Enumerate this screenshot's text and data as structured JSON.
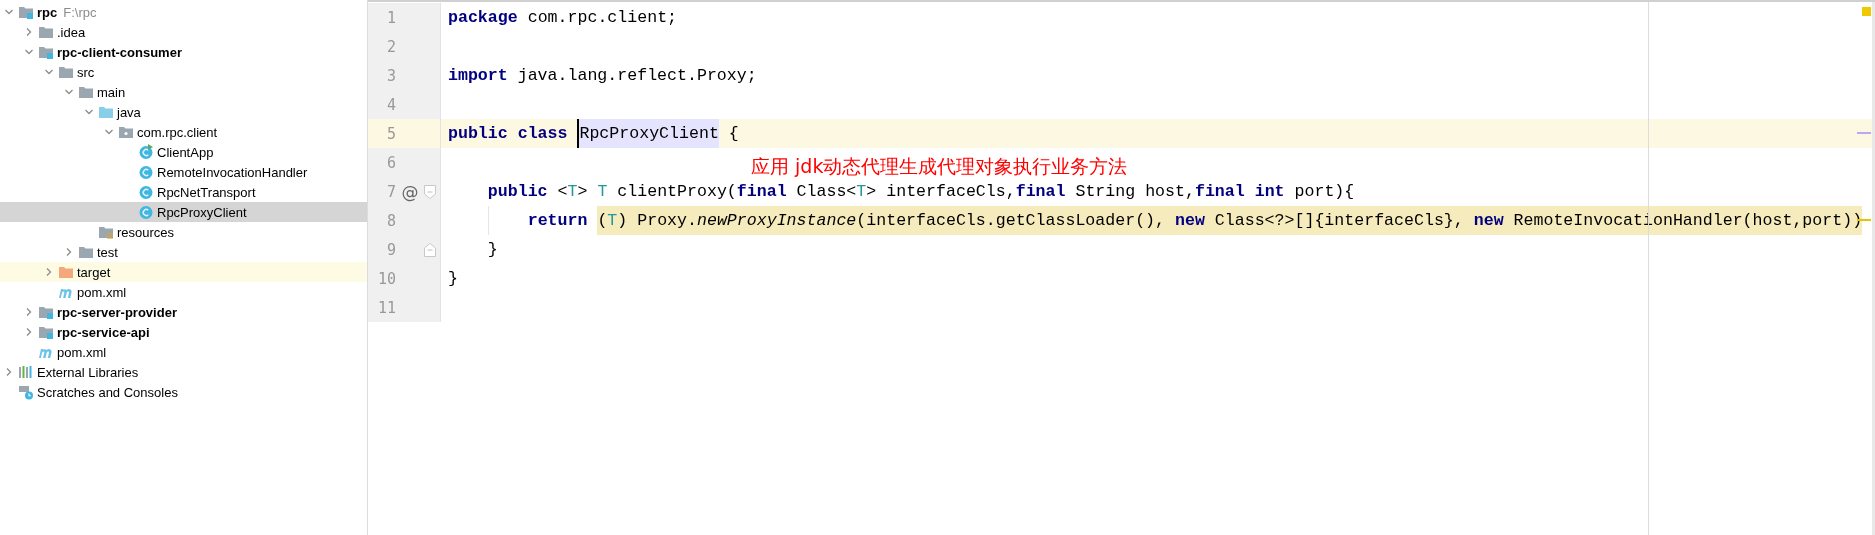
{
  "project_tree": [
    {
      "label": "rpc",
      "path": "F:\\rpc",
      "kind": "module",
      "bold": true,
      "expanded": true,
      "selected": false,
      "children": [
        {
          "label": ".idea",
          "kind": "folder",
          "bold": false,
          "expanded": false,
          "selected": false
        },
        {
          "label": "rpc-client-consumer",
          "kind": "module",
          "bold": true,
          "expanded": true,
          "selected": false,
          "children": [
            {
              "label": "src",
              "kind": "folder",
              "bold": false,
              "expanded": true,
              "selected": false,
              "children": [
                {
                  "label": "main",
                  "kind": "folder",
                  "bold": false,
                  "expanded": true,
                  "selected": false,
                  "children": [
                    {
                      "label": "java",
                      "kind": "source_folder",
                      "bold": false,
                      "expanded": true,
                      "selected": false,
                      "children": [
                        {
                          "label": "com.rpc.client",
                          "kind": "package",
                          "bold": false,
                          "expanded": true,
                          "selected": false,
                          "children": [
                            {
                              "label": "ClientApp",
                              "kind": "class_runnable",
                              "bold": false,
                              "selected": false
                            },
                            {
                              "label": "RemoteInvocationHandler",
                              "kind": "class",
                              "bold": false,
                              "selected": false
                            },
                            {
                              "label": "RpcNetTransport",
                              "kind": "class",
                              "bold": false,
                              "selected": false
                            },
                            {
                              "label": "RpcProxyClient",
                              "kind": "class",
                              "bold": false,
                              "selected": true
                            }
                          ]
                        }
                      ]
                    },
                    {
                      "label": "resources",
                      "kind": "resources",
                      "bold": false,
                      "selected": false
                    }
                  ]
                },
                {
                  "label": "test",
                  "kind": "folder",
                  "bold": false,
                  "expanded": false,
                  "selected": false
                }
              ]
            },
            {
              "label": "target",
              "kind": "excluded_folder",
              "bold": false,
              "expanded": false,
              "selected": false,
              "highlighted": true
            },
            {
              "label": "pom.xml",
              "kind": "maven",
              "bold": false,
              "selected": false
            }
          ]
        },
        {
          "label": "rpc-server-provider",
          "kind": "module",
          "bold": true,
          "expanded": false,
          "selected": false
        },
        {
          "label": "rpc-service-api",
          "kind": "module",
          "bold": true,
          "expanded": false,
          "selected": false
        },
        {
          "label": "pom.xml",
          "kind": "maven",
          "bold": false,
          "selected": false
        }
      ]
    },
    {
      "label": "External Libraries",
      "kind": "libraries",
      "bold": false,
      "expanded": false,
      "selected": false
    },
    {
      "label": "Scratches and Consoles",
      "kind": "scratches",
      "bold": false,
      "selected": false
    }
  ],
  "editor": {
    "lines": [
      {
        "number": "1",
        "current": false,
        "tokens": [
          {
            "text": "package",
            "kind": "keyword"
          },
          {
            "text": " com.rpc.client;",
            "kind": "plain"
          }
        ]
      },
      {
        "number": "2",
        "current": false
      },
      {
        "number": "3",
        "current": false,
        "tokens": [
          {
            "text": "import",
            "kind": "keyword"
          },
          {
            "text": " java.lang.reflect.Proxy;",
            "kind": "plain"
          }
        ]
      },
      {
        "number": "4",
        "current": false
      },
      {
        "number": "5",
        "current": true,
        "usage_stripe": true,
        "tokens": [
          {
            "text": "public class ",
            "kind": "keyword"
          },
          {
            "text": "RpcProxyClient",
            "kind": "plain",
            "usage": true,
            "caret": true
          },
          {
            "text": " {",
            "kind": "plain"
          }
        ]
      },
      {
        "number": "6",
        "current": false
      },
      {
        "number": "7",
        "current": false,
        "marker": "@",
        "fold_start": true,
        "tokens": [
          {
            "text": "public ",
            "kind": "keyword"
          },
          {
            "text": "<",
            "kind": "plain"
          },
          {
            "text": "T",
            "kind": "typeparam"
          },
          {
            "text": "> ",
            "kind": "plain"
          },
          {
            "text": "T",
            "kind": "typeparam"
          },
          {
            "text": " clientProxy(",
            "kind": "plain"
          },
          {
            "text": "final ",
            "kind": "keyword"
          },
          {
            "text": "Class<",
            "kind": "plain"
          },
          {
            "text": "T",
            "kind": "typeparam"
          },
          {
            "text": "> interfaceCls,",
            "kind": "plain"
          },
          {
            "text": "final ",
            "kind": "keyword"
          },
          {
            "text": "String host,",
            "kind": "plain"
          },
          {
            "text": "final int ",
            "kind": "keyword"
          },
          {
            "text": "port){",
            "kind": "plain"
          }
        ]
      },
      {
        "number": "8",
        "current": false,
        "warning_stripe": true,
        "tokens": [
          {
            "text": "return ",
            "kind": "keyword"
          },
          {
            "text": "(",
            "kind": "plain",
            "highlighted": true
          },
          {
            "text": "T",
            "kind": "typeparam",
            "highlighted": true
          },
          {
            "text": ") Proxy.",
            "kind": "plain",
            "highlighted": true
          },
          {
            "text": "newProxyInstance",
            "kind": "method",
            "highlighted": true
          },
          {
            "text": "(interfaceCls.getClassLoader(), ",
            "kind": "plain",
            "highlighted": true
          },
          {
            "text": "new ",
            "kind": "keyword",
            "highlighted": true
          },
          {
            "text": "Class<?>[]{interfaceCls}, ",
            "kind": "plain",
            "highlighted": true
          },
          {
            "text": "new ",
            "kind": "keyword",
            "highlighted": true
          },
          {
            "text": "RemoteInvocationHandler(host,port))",
            "kind": "plain",
            "highlighted": true
          }
        ]
      },
      {
        "number": "9",
        "current": false,
        "fold_end": true,
        "tokens": [
          {
            "text": "}",
            "kind": "plain"
          }
        ]
      },
      {
        "number": "10",
        "current": false,
        "tokens": [
          {
            "text": "}",
            "kind": "plain"
          }
        ]
      },
      {
        "number": "11",
        "current": false
      }
    ]
  },
  "annotation": {
    "text": "应用 jdk动态代理生成代理对象执行业务方法"
  }
}
